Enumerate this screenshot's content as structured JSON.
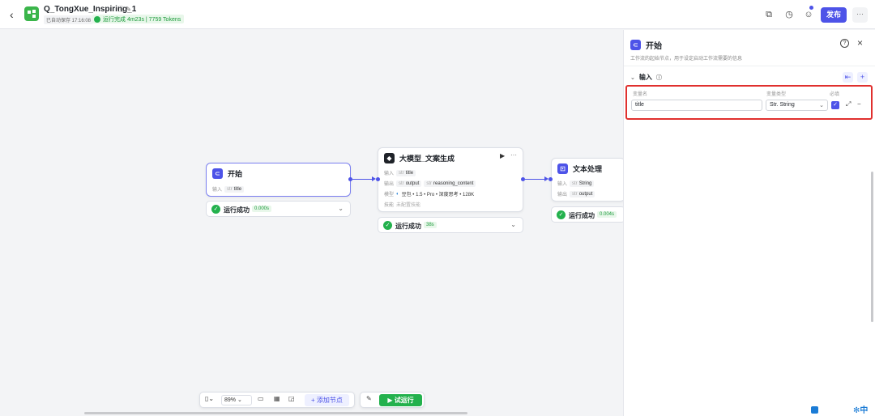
{
  "header": {
    "title": "Q_TongXue_Inspiring_1",
    "autosave": "已自动保存 17:16:08",
    "run_status": "运行完成 4m23s | 7759 Tokens",
    "publish_label": "发布",
    "more_label": "···"
  },
  "nodes": {
    "start": {
      "title": "开始",
      "input_label": "输入",
      "input_tag_type": "str",
      "input_tag": "title",
      "status": "运行成功",
      "duration": "0.000s"
    },
    "llm": {
      "title": "大模型_文案生成",
      "input_label": "输入",
      "input_tag_type": "str",
      "input_tag": "title",
      "output_label": "输出",
      "output_tag1_type": "str",
      "output_tag1": "output",
      "output_tag2_type": "str",
      "output_tag2": "reasoning_content",
      "model_label": "模型",
      "model_value": "豆包 • 1.5 • Pro • 深度思考 • 128K",
      "skill_label": "技能",
      "skill_value": "未配置技能",
      "status": "运行成功",
      "duration": "38s"
    },
    "text": {
      "title": "文本处理",
      "input_label": "输入",
      "input_tag_type": "str",
      "input_tag": "String",
      "output_label": "输出",
      "output_tag_type": "str",
      "output_tag": "output",
      "status": "运行成功",
      "duration": "0.004s"
    }
  },
  "toolbar": {
    "zoom": "89%",
    "add_node": "+ 添加节点",
    "test_run": "▶ 试运行"
  },
  "panel": {
    "title": "开始",
    "description": "工作流的起始节点，用于设定启动工作流需要的信息",
    "section_title": "输入",
    "col_name": "变量名",
    "col_type": "变量类型",
    "col_required": "必填",
    "var_name": "title",
    "var_type": "Str. String"
  },
  "bottom_right": {
    "ime_label": "中"
  },
  "colors": {
    "accent": "#4d53e8",
    "success": "#23b14d",
    "highlight_border": "#e0302e"
  }
}
